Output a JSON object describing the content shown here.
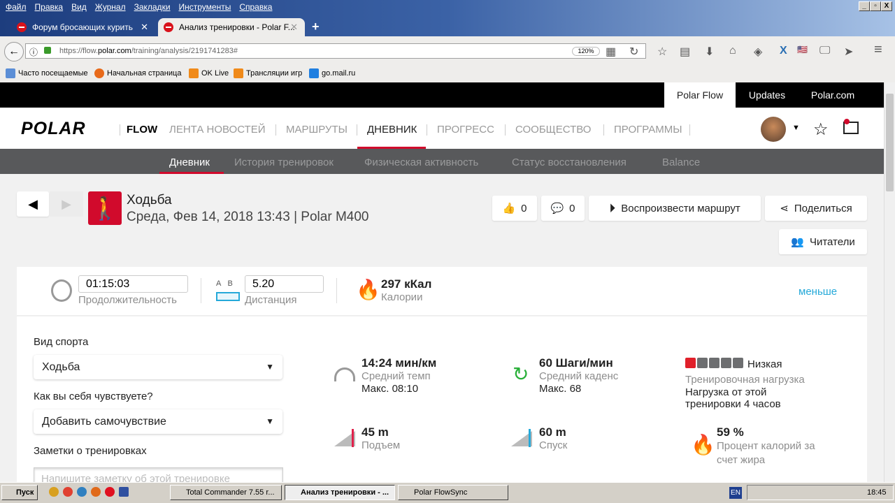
{
  "browser": {
    "menu": [
      "Файл",
      "Правка",
      "Вид",
      "Журнал",
      "Закладки",
      "Инструменты",
      "Справка"
    ],
    "tabs": [
      {
        "title": "Форум бросающих курить"
      },
      {
        "title": "Анализ тренировки - Polar F..."
      }
    ],
    "url_prefix": "https://flow.",
    "url_domain": "polar.com",
    "url_path": "/training/analysis/2191741283#",
    "zoom": "120%",
    "bookmarks": [
      "Часто посещаемые",
      "Начальная страница",
      "OK Live",
      "Трансляции игр",
      "go.mail.ru"
    ]
  },
  "site_top": {
    "links": [
      "Polar Flow",
      "Updates",
      "Polar.com"
    ]
  },
  "header": {
    "logo": "POLAR",
    "flow": "FLOW",
    "nav": [
      "ЛЕНТА НОВОСТЕЙ",
      "МАРШРУТЫ",
      "ДНЕВНИК",
      "ПРОГРЕСС",
      "СООБЩЕСТВО",
      "ПРОГРАММЫ"
    ]
  },
  "subnav": [
    "Дневник",
    "История тренировок",
    "Физическая активность",
    "Статус восстановления",
    "Balance"
  ],
  "training": {
    "sport": "Ходьба",
    "subtitle": "Среда, Фев 14, 2018 13:43 | Polar M400",
    "likes": "0",
    "comments": "0",
    "replay": "Воспроизвести маршрут",
    "share": "Поделиться",
    "followers": "Читатели"
  },
  "summary": {
    "duration": "01:15:03",
    "duration_label": "Продолжительность",
    "ab_a": "A",
    "ab_b": "B",
    "distance": "5.20",
    "distance_label": "Дистанция",
    "calories": "297 кКал",
    "calories_label": "Калории",
    "less": "меньше"
  },
  "form": {
    "sport_label": "Вид спорта",
    "sport_value": "Ходьба",
    "feel_label": "Как вы себя чувствуете?",
    "feel_value": "Добавить самочувствие",
    "notes_label": "Заметки о тренировках",
    "notes_placeholder": "Напишите заметку об этой тренировке"
  },
  "stats": {
    "pace": "14:24 мин/км",
    "pace_label": "Средний темп",
    "pace_max": "Макс. 08:10",
    "cadence": "60 Шаги/мин",
    "cadence_label": "Средний каденс",
    "cadence_max": "Макс. 68",
    "load_level": "Низкая",
    "load_label": "Тренировочная нагрузка",
    "load_desc": "Нагрузка от этой тренировки 4 часов",
    "load_filled": 1,
    "load_total": 5,
    "ascent": "45 m",
    "ascent_label": "Подъем",
    "descent": "60 m",
    "descent_label": "Спуск",
    "fat": "59 %",
    "fat_label": "Процент калорий за счет жира"
  },
  "taskbar": {
    "start": "Пуск",
    "tasks": [
      "Total Commander 7.55 r...",
      "Анализ тренировки - ...",
      "Polar FlowSync"
    ],
    "lang": "EN",
    "clock": "18:45"
  },
  "colors": {
    "polar_red": "#d10a2c",
    "link": "#25a9d9",
    "subnav": "#58595b"
  }
}
